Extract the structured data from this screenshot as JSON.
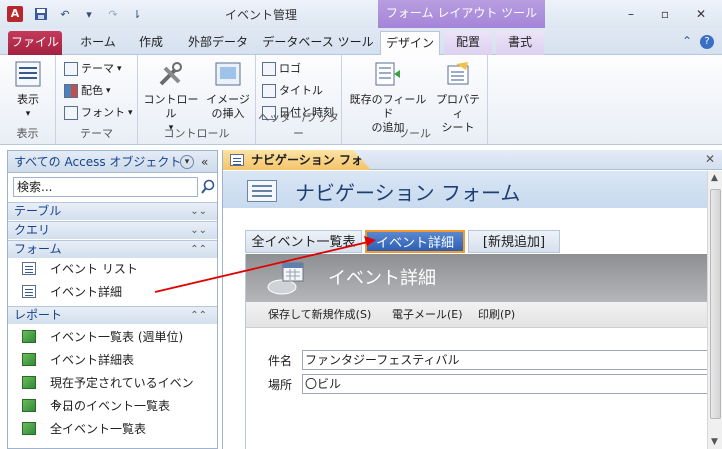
{
  "app": {
    "icon_letter": "A",
    "window_title": "イベント管理",
    "context_tools_header": "フォーム レイアウト ツール"
  },
  "qat": {
    "save": "💾",
    "undo": "↶",
    "redo": "↷",
    "customize": "▾"
  },
  "window_controls": {
    "minimize": "–",
    "restore": "▫",
    "close": "✕"
  },
  "tabs": [
    {
      "label": "ファイル"
    },
    {
      "label": "ホーム"
    },
    {
      "label": "作成"
    },
    {
      "label": "外部データ"
    },
    {
      "label": "データベース ツール"
    },
    {
      "label": "デザイン"
    },
    {
      "label": "配置"
    },
    {
      "label": "書式"
    }
  ],
  "tab_right": {
    "minimize_ribbon": "⌃",
    "help": "?"
  },
  "ribbon": {
    "groups": {
      "view": {
        "label": "表示",
        "button": "表示"
      },
      "theme": {
        "label": "テーマ",
        "theme_btn": "テーマ",
        "color_btn": "配色",
        "font_btn": "フォント"
      },
      "controls": {
        "label": "コントロール",
        "controls_btn": "コントロール",
        "image_btn_line1": "イメージ",
        "image_btn_line2": "の挿入"
      },
      "header_footer": {
        "label": "ヘッダー/フッター",
        "logo_btn": "ロゴ",
        "title_btn": "タイトル",
        "datetime_btn": "日付と時刻"
      },
      "tools": {
        "label": "ツール",
        "add_fields_line1": "既存のフィールド",
        "add_fields_line2": "の追加",
        "property_line1": "プロパティ",
        "property_line2": "シート"
      }
    }
  },
  "nav_pane": {
    "header": "すべての Access オブジェクト",
    "search_placeholder": "検索...",
    "categories": {
      "tables": "テーブル",
      "queries": "クエリ",
      "forms": "フォーム",
      "reports": "レポート"
    },
    "forms": [
      "イベント リスト",
      "イベント詳細"
    ],
    "reports": [
      "イベント一覧表 (週単位)",
      "イベント詳細表",
      "現在予定されているイベント...",
      "今日のイベント一覧表",
      "全イベント一覧表"
    ]
  },
  "document": {
    "tab_label": "ナビゲーション フォーム",
    "form_title": "ナビゲーション フォーム",
    "nav_tabs": [
      "全イベント一覧表",
      "イベント詳細",
      "[新規追加]"
    ],
    "subform": {
      "title": "イベント詳細",
      "toolbar": [
        "保存して新規作成(S)",
        "電子メール(E)",
        "印刷(P)"
      ],
      "fields": [
        {
          "label": "件名",
          "value": "ファンタジーフェスティバル"
        },
        {
          "label": "場所",
          "value": "〇ビル"
        }
      ]
    }
  },
  "colors": {
    "file_tab": "#b62b4b",
    "context_header": "#a88ad8",
    "selected_nav_tab": "#2c5fb4",
    "highlight_border": "#f59a28",
    "annotation_arrow": "#e00000"
  }
}
